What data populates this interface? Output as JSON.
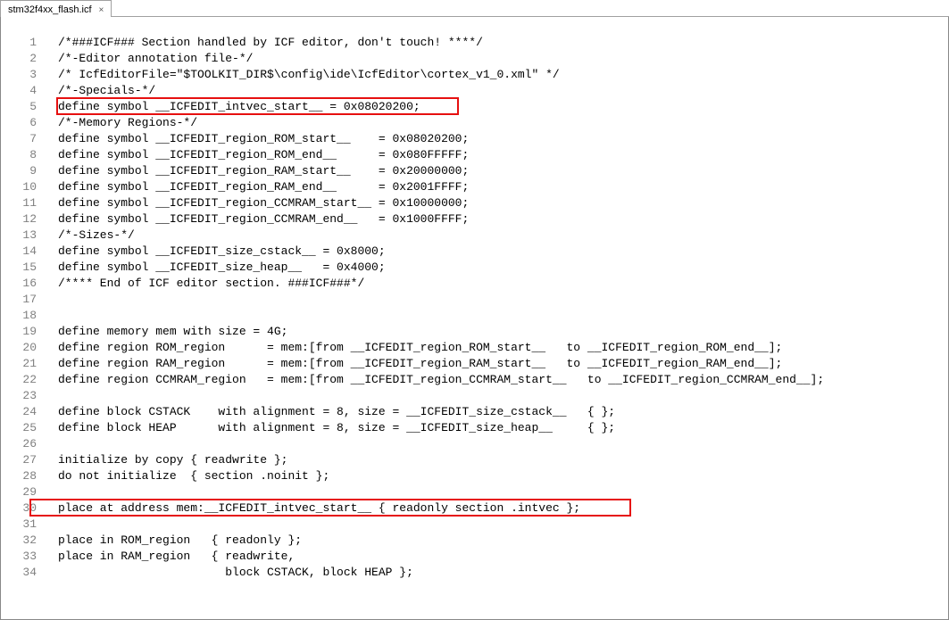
{
  "tab": {
    "title": "stm32f4xx_flash.icf",
    "close": "×"
  },
  "lines": [
    "/*###ICF### Section handled by ICF editor, don't touch! ****/",
    "/*-Editor annotation file-*/",
    "/* IcfEditorFile=\"$TOOLKIT_DIR$\\config\\ide\\IcfEditor\\cortex_v1_0.xml\" */",
    "/*-Specials-*/",
    "define symbol __ICFEDIT_intvec_start__ = 0x08020200;",
    "/*-Memory Regions-*/",
    "define symbol __ICFEDIT_region_ROM_start__    = 0x08020200;",
    "define symbol __ICFEDIT_region_ROM_end__      = 0x080FFFFF;",
    "define symbol __ICFEDIT_region_RAM_start__    = 0x20000000;",
    "define symbol __ICFEDIT_region_RAM_end__      = 0x2001FFFF;",
    "define symbol __ICFEDIT_region_CCMRAM_start__ = 0x10000000;",
    "define symbol __ICFEDIT_region_CCMRAM_end__   = 0x1000FFFF;",
    "/*-Sizes-*/",
    "define symbol __ICFEDIT_size_cstack__ = 0x8000;",
    "define symbol __ICFEDIT_size_heap__   = 0x4000;",
    "/**** End of ICF editor section. ###ICF###*/",
    "",
    "",
    "define memory mem with size = 4G;",
    "define region ROM_region      = mem:[from __ICFEDIT_region_ROM_start__   to __ICFEDIT_region_ROM_end__];",
    "define region RAM_region      = mem:[from __ICFEDIT_region_RAM_start__   to __ICFEDIT_region_RAM_end__];",
    "define region CCMRAM_region   = mem:[from __ICFEDIT_region_CCMRAM_start__   to __ICFEDIT_region_CCMRAM_end__];",
    "",
    "define block CSTACK    with alignment = 8, size = __ICFEDIT_size_cstack__   { };",
    "define block HEAP      with alignment = 8, size = __ICFEDIT_size_heap__     { };",
    "",
    "initialize by copy { readwrite };",
    "do not initialize  { section .noinit };",
    "",
    "place at address mem:__ICFEDIT_intvec_start__ { readonly section .intvec };",
    "",
    "place in ROM_region   { readonly };",
    "place in RAM_region   { readwrite,",
    "                        block CSTACK, block HEAP };"
  ],
  "nums": [
    "1",
    "2",
    "3",
    "4",
    "5",
    "6",
    "7",
    "8",
    "9",
    "10",
    "11",
    "12",
    "13",
    "14",
    "15",
    "16",
    "17",
    "18",
    "19",
    "20",
    "21",
    "22",
    "23",
    "24",
    "25",
    "26",
    "27",
    "28",
    "29",
    "30",
    "31",
    "32",
    "33",
    "34"
  ]
}
